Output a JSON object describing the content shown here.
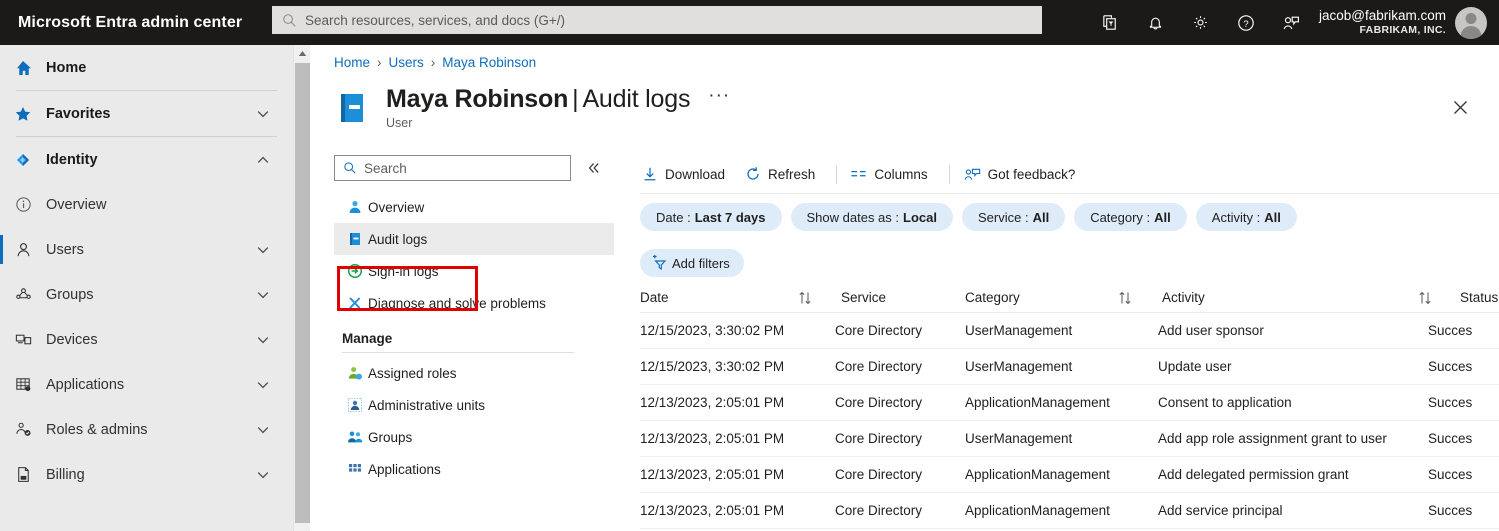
{
  "topbar": {
    "brand": "Microsoft Entra admin center",
    "search_placeholder": "Search resources, services, and docs (G+/)",
    "icons": [
      "directories-filter-icon",
      "notifications-bell-icon",
      "settings-gear-icon",
      "help-question-icon",
      "feedback-person-icon"
    ],
    "account_email": "jacob@fabrikam.com",
    "account_org": "FABRIKAM, INC."
  },
  "leftnav": {
    "items": [
      {
        "label": "Home",
        "icon": "home-icon",
        "level": 1,
        "chevron": "none",
        "active": false
      },
      {
        "label": "Favorites",
        "icon": "star-icon",
        "level": 1,
        "chevron": "down",
        "active": false
      },
      {
        "label": "Identity",
        "icon": "identity-diamond-icon",
        "level": 1,
        "chevron": "up",
        "active": false
      },
      {
        "label": "Overview",
        "icon": "info-circle-icon",
        "level": 2,
        "chevron": "none",
        "active": false
      },
      {
        "label": "Users",
        "icon": "user-icon",
        "level": 2,
        "chevron": "down",
        "active": true
      },
      {
        "label": "Groups",
        "icon": "groups-icon",
        "level": 2,
        "chevron": "down",
        "active": false
      },
      {
        "label": "Devices",
        "icon": "devices-icon",
        "level": 2,
        "chevron": "down",
        "active": false
      },
      {
        "label": "Applications",
        "icon": "applications-grid-icon",
        "level": 2,
        "chevron": "down",
        "active": false
      },
      {
        "label": "Roles & admins",
        "icon": "roles-admins-icon",
        "level": 2,
        "chevron": "down",
        "active": false
      },
      {
        "label": "Billing",
        "icon": "billing-document-icon",
        "level": 2,
        "chevron": "down",
        "active": false
      }
    ]
  },
  "blade": {
    "breadcrumb": [
      "Home",
      "Users",
      "Maya Robinson"
    ],
    "title_main": "Maya Robinson",
    "title_separator": "|",
    "title_sub": "Audit logs",
    "title_ellipsis": "···",
    "subtitle": "User",
    "close_label": "×"
  },
  "innernav": {
    "search_placeholder": "Search",
    "collapse_icon": "chevron-double-left-icon",
    "items": [
      {
        "label": "Overview",
        "icon": "user-overview-icon",
        "selected": false
      },
      {
        "label": "Audit logs",
        "icon": "audit-logs-book-icon",
        "selected": true
      },
      {
        "label": "Sign-in logs",
        "icon": "sign-in-logs-icon",
        "selected": false
      },
      {
        "label": "Diagnose and solve problems",
        "icon": "diagnose-wrench-icon",
        "selected": false
      }
    ],
    "group_title": "Manage",
    "manage_items": [
      {
        "label": "Assigned roles",
        "icon": "assigned-roles-icon",
        "selected": false
      },
      {
        "label": "Administrative units",
        "icon": "administrative-units-icon",
        "selected": false
      },
      {
        "label": "Groups",
        "icon": "groups-people-icon",
        "selected": false
      },
      {
        "label": "Applications",
        "icon": "applications-grid-icon",
        "selected": false
      }
    ]
  },
  "commandbar": {
    "items": [
      {
        "label": "Download",
        "icon": "download-arrow-icon",
        "sep_after": false
      },
      {
        "label": "Refresh",
        "icon": "refresh-circular-icon",
        "sep_after": true
      },
      {
        "label": "Columns",
        "icon": "columns-icon",
        "sep_after": true
      },
      {
        "label": "Got feedback?",
        "icon": "feedback-person-icon",
        "sep_after": false
      }
    ]
  },
  "filters": {
    "pills": [
      {
        "key": "Date :",
        "value": "Last 7 days"
      },
      {
        "key": "Show dates as :",
        "value": "Local"
      },
      {
        "key": "Service :",
        "value": "All"
      },
      {
        "key": "Category :",
        "value": "All"
      },
      {
        "key": "Activity :",
        "value": "All"
      }
    ],
    "add_filters_label": "Add filters",
    "add_filters_icon": "add-filter-icon"
  },
  "table": {
    "columns": [
      {
        "label": "Date",
        "sortable": true,
        "sort_icon_before": false
      },
      {
        "label": "Service",
        "sortable": false,
        "sort_icon_before": true
      },
      {
        "label": "Category",
        "sortable": false,
        "sort_icon_before": false
      },
      {
        "label": "Activity",
        "sortable": false,
        "sort_icon_before": true
      },
      {
        "label": "Status",
        "sortable": false,
        "sort_icon_before": true
      }
    ],
    "rows": [
      {
        "date": "12/15/2023, 3:30:02 PM",
        "service": "Core Directory",
        "category": "UserManagement",
        "activity": "Add user sponsor",
        "status": "Succes"
      },
      {
        "date": "12/15/2023, 3:30:02 PM",
        "service": "Core Directory",
        "category": "UserManagement",
        "activity": "Update user",
        "status": "Succes"
      },
      {
        "date": "12/13/2023, 2:05:01 PM",
        "service": "Core Directory",
        "category": "ApplicationManagement",
        "activity": "Consent to application",
        "status": "Succes"
      },
      {
        "date": "12/13/2023, 2:05:01 PM",
        "service": "Core Directory",
        "category": "UserManagement",
        "activity": "Add app role assignment grant to user",
        "status": "Succes"
      },
      {
        "date": "12/13/2023, 2:05:01 PM",
        "service": "Core Directory",
        "category": "ApplicationManagement",
        "activity": "Add delegated permission grant",
        "status": "Succes"
      },
      {
        "date": "12/13/2023, 2:05:01 PM",
        "service": "Core Directory",
        "category": "ApplicationManagement",
        "activity": "Add service principal",
        "status": "Succes"
      }
    ]
  },
  "colors": {
    "topbar_bg": "#1b1a19",
    "accent_blue": "#0f6cbd",
    "pill_bg": "#deecf9",
    "highlight_red": "#e00000",
    "sidebar_bg": "#eaeaea",
    "selected_row_bg": "#ebebeb"
  }
}
